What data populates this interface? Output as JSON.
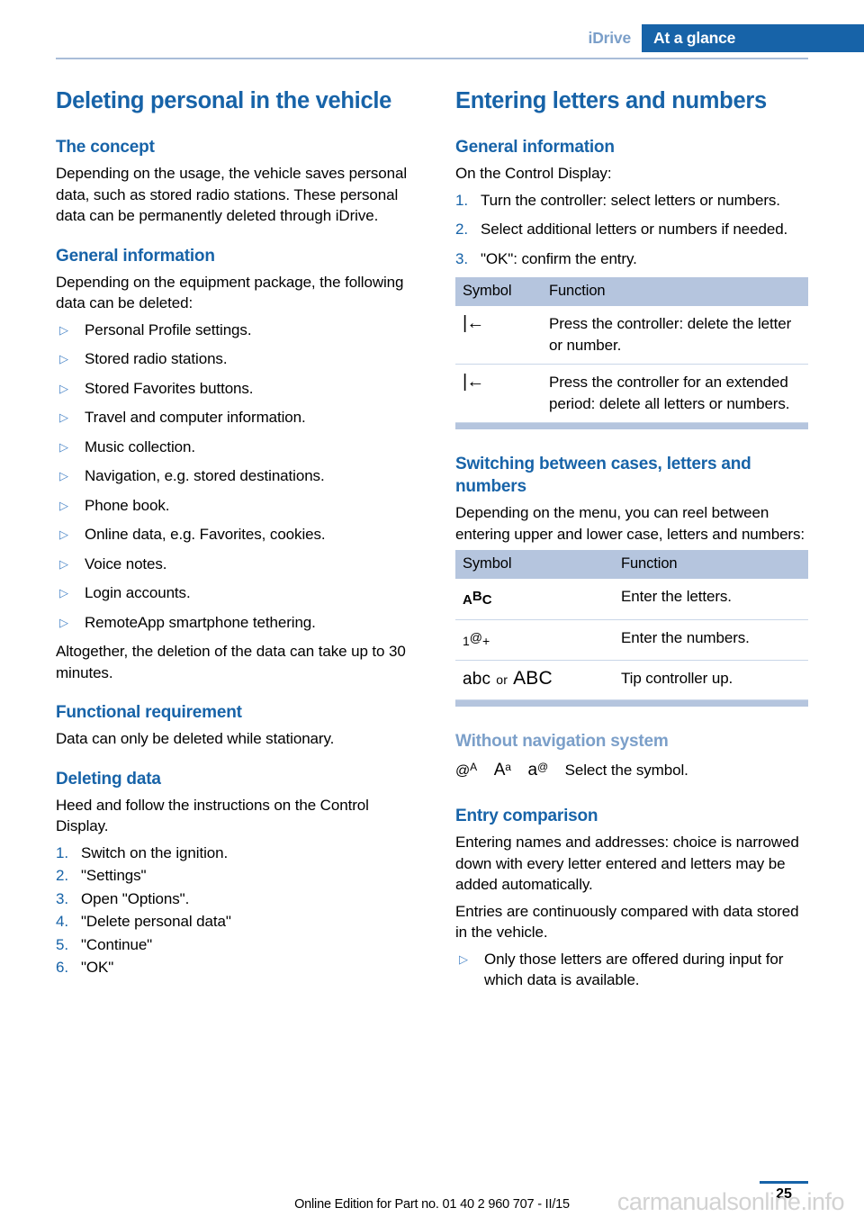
{
  "header": {
    "breadcrumb": "iDrive",
    "section": "At a glance"
  },
  "left_column": {
    "chapter_title": "Deleting personal in the vehicle",
    "concept": {
      "heading": "The concept",
      "paragraph": "Depending on the usage, the vehicle saves personal data, such as stored radio stations. These personal data can be permanently deleted through iDrive."
    },
    "general_information": {
      "heading": "General information",
      "intro": "Depending on the equipment package, the following data can be deleted:",
      "items": [
        "Personal Profile settings.",
        "Stored radio stations.",
        "Stored Favorites buttons.",
        "Travel and computer information.",
        "Music collection.",
        "Navigation, e.g. stored destinations.",
        "Phone book.",
        "Online data, e.g. Favorites, cookies.",
        "Voice notes.",
        "Login accounts.",
        "RemoteApp smartphone tethering."
      ],
      "closing": "Altogether, the deletion of the data can take up to 30 minutes."
    },
    "functional_requirement": {
      "heading": "Functional requirement",
      "paragraph": "Data can only be deleted while stationary."
    },
    "deleting_data": {
      "heading": "Deleting data",
      "paragraph": "Heed and follow the instructions on the Control Display.",
      "steps": [
        {
          "number": "1.",
          "text": "Switch on the ignition."
        },
        {
          "number": "2.",
          "text": "\"Settings\""
        },
        {
          "number": "3.",
          "text": "Open \"Options\"."
        },
        {
          "number": "4.",
          "text": "\"Delete personal data\""
        },
        {
          "number": "5.",
          "text": "\"Continue\""
        },
        {
          "number": "6.",
          "text": "\"OK\""
        }
      ]
    }
  },
  "right_column": {
    "chapter_title": "Entering letters and numbers",
    "general_information": {
      "heading": "General information",
      "intro": "On the Control Display:",
      "steps": [
        {
          "number": "1.",
          "text": "Turn the controller: select letters or numbers."
        },
        {
          "number": "2.",
          "text": "Select additional letters or numbers if needed."
        },
        {
          "number": "3.",
          "text": "\"OK\": confirm the entry."
        }
      ]
    },
    "table_delete": {
      "columns": [
        "Symbol",
        "Function"
      ],
      "rows": [
        {
          "symbol_name": "backspace-icon",
          "function": "Press the controller: delete the letter or number."
        },
        {
          "symbol_name": "backspace-icon",
          "function": "Press the controller for an extended period: delete all letters or numbers."
        }
      ]
    },
    "switching": {
      "heading": "Switching between cases, letters and numbers",
      "paragraph": "Depending on the menu, you can reel between entering upper and lower case, letters and numbers:"
    },
    "table_cases": {
      "columns": [
        "Symbol",
        "Function"
      ],
      "rows": [
        {
          "symbol_name": "abc-letters-icon",
          "symbol_parts": {
            "a": "A",
            "b": "B",
            "c": "C"
          },
          "function": "Enter the letters."
        },
        {
          "symbol_name": "numbers-symbol-icon",
          "symbol_parts": {
            "one": "1",
            "at": "@",
            "plus": "+"
          },
          "function": "Enter the numbers."
        },
        {
          "symbol_name": "case-toggle-icon",
          "symbol_parts": {
            "lower": "abc",
            "or": "or",
            "upper": "ABC"
          },
          "function": "Tip controller up."
        }
      ]
    },
    "without_navigation": {
      "heading": "Without navigation system",
      "symbols": [
        {
          "name": "at-upper-a-icon",
          "base": "@",
          "sup": "A"
        },
        {
          "name": "upper-a-lower-a-icon",
          "base": "A",
          "sup": "a"
        },
        {
          "name": "lower-a-at-icon",
          "base": "a",
          "sup": "@"
        }
      ],
      "text": "Select the symbol."
    },
    "entry_comparison": {
      "heading": "Entry comparison",
      "paragraph_1": "Entering names and addresses: choice is narrowed down with every letter entered and letters may be added automatically.",
      "paragraph_2": "Entries are continuously compared with data stored in the vehicle.",
      "bullets": [
        "Only those letters are offered during input for which data is available."
      ]
    }
  },
  "footer": {
    "edition_text": "Online Edition for Part no. 01 40 2 960 707 - II/15",
    "page_number": "25",
    "watermark": "carmanualsonline.info"
  },
  "colors": {
    "accent_blue": "#1763a8",
    "light_blue": "#7b9fc9",
    "table_header_bg": "#b5c5de",
    "rule": "#a9bdd8"
  }
}
